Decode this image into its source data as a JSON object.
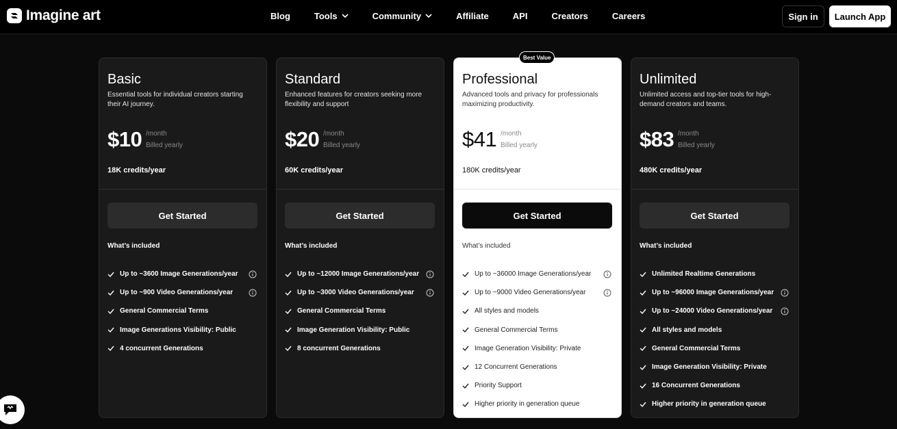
{
  "header": {
    "brand": "Imagine art",
    "nav": [
      {
        "label": "Blog",
        "dropdown": false
      },
      {
        "label": "Tools",
        "dropdown": true
      },
      {
        "label": "Community",
        "dropdown": true
      },
      {
        "label": "Affiliate",
        "dropdown": false
      },
      {
        "label": "API",
        "dropdown": false
      },
      {
        "label": "Creators",
        "dropdown": false
      },
      {
        "label": "Careers",
        "dropdown": false
      }
    ],
    "sign_in": "Sign in",
    "launch_app": "Launch App"
  },
  "plans": [
    {
      "name": "Basic",
      "description": "Essential tools for individual creators starting their AI journey.",
      "price": "$10",
      "per": "/month",
      "billed": "Billed yearly",
      "credits": "18K credits/year",
      "cta": "Get Started",
      "included_label": "What’s included",
      "features": [
        {
          "text": "Up to ~3600 Image Generations/year",
          "info": true
        },
        {
          "text": "Up to ~900 Video Generations/year",
          "info": true
        },
        {
          "text": "General Commercial Terms",
          "info": false
        },
        {
          "text": "Image Generations Visibility: Public",
          "info": false
        },
        {
          "text": "4 concurrent Generations",
          "info": false
        }
      ]
    },
    {
      "name": "Standard",
      "description": "Enhanced features for creators seeking more flexibility and support",
      "price": "$20",
      "per": "/month",
      "billed": "Billed yearly",
      "credits": "60K credits/year",
      "cta": "Get Started",
      "included_label": "What’s included",
      "features": [
        {
          "text": "Up to ~12000 Image Generations/year",
          "info": true
        },
        {
          "text": "Up to ~3000 Video Generations/year",
          "info": true
        },
        {
          "text": "General Commercial Terms",
          "info": false
        },
        {
          "text": "Image Generation Visibility: Public",
          "info": false
        },
        {
          "text": "8 concurrent Generations",
          "info": false
        }
      ]
    },
    {
      "name": "Professional",
      "badge": "Best Value",
      "description": "Advanced tools and privacy for professionals maximizing productivity.",
      "price": "$41",
      "per": "/month",
      "billed": "Billed yearly",
      "credits": "180K credits/year",
      "cta": "Get Started",
      "included_label": "What’s included",
      "features": [
        {
          "text": "Up to ~36000 Image Generations/year",
          "info": true
        },
        {
          "text": "Up to ~9000 Video Generations/year",
          "info": true
        },
        {
          "text": "All styles and models",
          "info": false
        },
        {
          "text": "General Commercial Terms",
          "info": false
        },
        {
          "text": "Image Generation Visibility: Private",
          "info": false
        },
        {
          "text": "12 Concurrent Generations",
          "info": false
        },
        {
          "text": "Priority Support",
          "info": false
        },
        {
          "text": "Higher priority in generation queue",
          "info": false
        }
      ]
    },
    {
      "name": "Unlimited",
      "description": "Unlimited access and top-tier tools for high-demand creators and teams.",
      "price": "$83",
      "per": "/month",
      "billed": "Billed yearly",
      "credits": "480K credits/year",
      "cta": "Get Started",
      "included_label": "What’s included",
      "features": [
        {
          "text": "Unlimited Realtime Generations",
          "info": false
        },
        {
          "text": "Up to ~96000 Image Generations/year",
          "info": true
        },
        {
          "text": "Up to ~24000 Video Generations/year",
          "info": true
        },
        {
          "text": "All styles and models",
          "info": false
        },
        {
          "text": "General Commercial Terms",
          "info": false
        },
        {
          "text": "Image Generation Visibility: Private",
          "info": false
        },
        {
          "text": "16 Concurrent Generations",
          "info": false
        },
        {
          "text": "Higher priority in generation queue",
          "info": false
        }
      ]
    }
  ],
  "chat": {
    "icon": "chat-icon"
  }
}
